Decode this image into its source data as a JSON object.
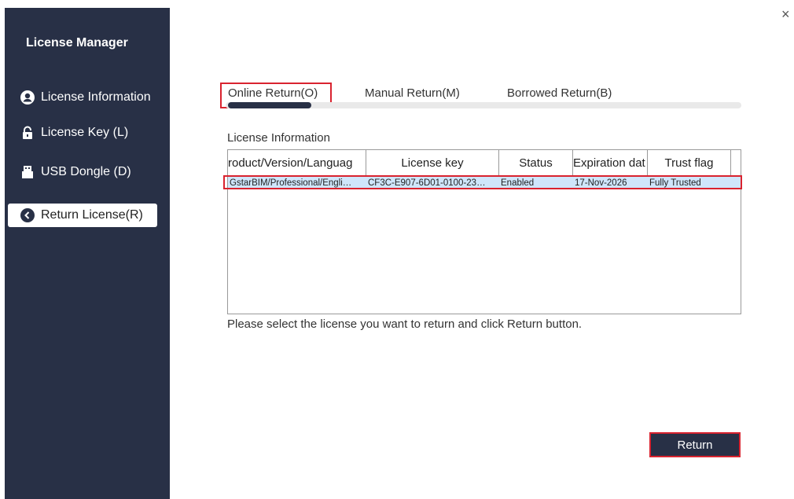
{
  "app": {
    "title": "License Manager",
    "close_glyph": "×"
  },
  "sidebar": {
    "items": [
      {
        "label": "License Information",
        "icon": "user-icon",
        "active": false
      },
      {
        "label": "License Key (L)",
        "icon": "lock-icon",
        "active": false
      },
      {
        "label": "USB Dongle (D)",
        "icon": "usb-icon",
        "active": false
      },
      {
        "label": "Return License(R)",
        "icon": "back-circle-icon",
        "active": true
      }
    ]
  },
  "tabs": [
    {
      "label": "Online Return(O)",
      "active": true
    },
    {
      "label": "Manual Return(M)",
      "active": false
    },
    {
      "label": "Borrowed Return(B)",
      "active": false
    }
  ],
  "license_table": {
    "section_label": "License Information",
    "columns": [
      "roduct/Version/Languag",
      "License key",
      "Status",
      "Expiration dat",
      "Trust flag"
    ],
    "rows": [
      {
        "product": "GstarBIM/Professional/Engli…",
        "license_key": "CF3C-E907-6D01-0100-23…",
        "status": "Enabled",
        "expiration": "17-Nov-2026",
        "trust_flag": "Fully Trusted"
      }
    ]
  },
  "hint": "Please select the license you want to return and  click Return button.",
  "actions": {
    "return_label": "Return"
  },
  "colors": {
    "sidebar_bg": "#283046",
    "highlight": "#d9232f",
    "selected_row": "#cfe6fb"
  }
}
